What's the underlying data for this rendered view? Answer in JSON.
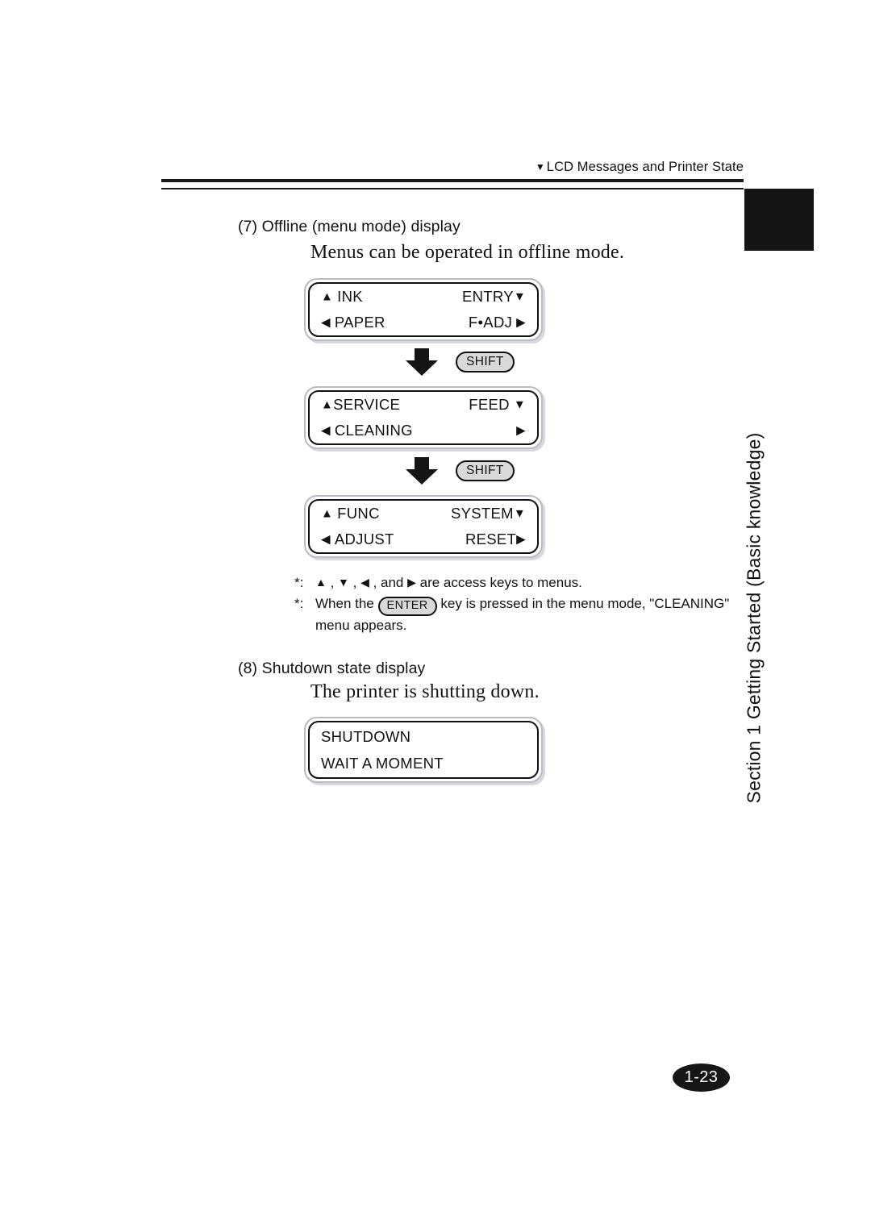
{
  "header": {
    "marker": "▼",
    "title": "LCD Messages and Printer State"
  },
  "side_tab": {
    "section_label": "Section 1  Getting Started (Basic knowledge)"
  },
  "section7": {
    "heading": "(7) Offline (menu mode) display",
    "caption": "Menus can be operated in offline mode.",
    "displays": [
      {
        "row1_left_glyph": "▲",
        "row1_left_text": "INK",
        "row1_right_text": "ENTRY",
        "row1_right_glyph": "▼",
        "row2_left_glyph": "◀",
        "row2_left_text": "PAPER",
        "row2_right_text": "F•ADJ",
        "row2_right_glyph": "▶"
      },
      {
        "row1_left_glyph": "▲",
        "row1_left_text": "SERVICE",
        "row1_right_text": "FEED",
        "row1_right_glyph": "▼",
        "row2_left_glyph": "◀",
        "row2_left_text": "CLEANING",
        "row2_right_text": "",
        "row2_right_glyph": "▶"
      },
      {
        "row1_left_glyph": "▲",
        "row1_left_text": "FUNC",
        "row1_right_text": "SYSTEM",
        "row1_right_glyph": "▼",
        "row2_left_glyph": "◀",
        "row2_left_text": "ADJUST",
        "row2_right_text": "RESET",
        "row2_right_glyph": "▶"
      }
    ],
    "shift_key_label": "SHIFT",
    "notes": [
      {
        "mark": "*:",
        "parts": [
          {
            "type": "glyph",
            "text": "▲"
          },
          {
            "type": "text",
            "text": " , "
          },
          {
            "type": "glyph",
            "text": "▼"
          },
          {
            "type": "text",
            "text": " , "
          },
          {
            "type": "glyph",
            "text": "◀"
          },
          {
            "type": "text",
            "text": " , and "
          },
          {
            "type": "glyph",
            "text": "▶"
          },
          {
            "type": "text",
            "text": "  are access keys to menus."
          }
        ],
        "plain": "▲ , ▼ , ◀ , and ▶  are access keys to menus."
      },
      {
        "mark": "*:",
        "prefix": "When the",
        "key": "ENTER",
        "suffix": "key is pressed in the menu mode, \"CLEANING\"",
        "continuation": "menu appears."
      }
    ]
  },
  "section8": {
    "heading": "(8) Shutdown state display",
    "caption": "The printer is shutting down.",
    "display": {
      "line1": "SHUTDOWN",
      "line2": "WAIT A MOMENT"
    }
  },
  "footer": {
    "page_number": "1-23"
  },
  "colors": {
    "ink": "#111111",
    "key_fill": "#d9d9d9",
    "panel_border": "#b9bcc4",
    "panel_shadow": "#d6d8dd",
    "tab_black": "#151515"
  }
}
